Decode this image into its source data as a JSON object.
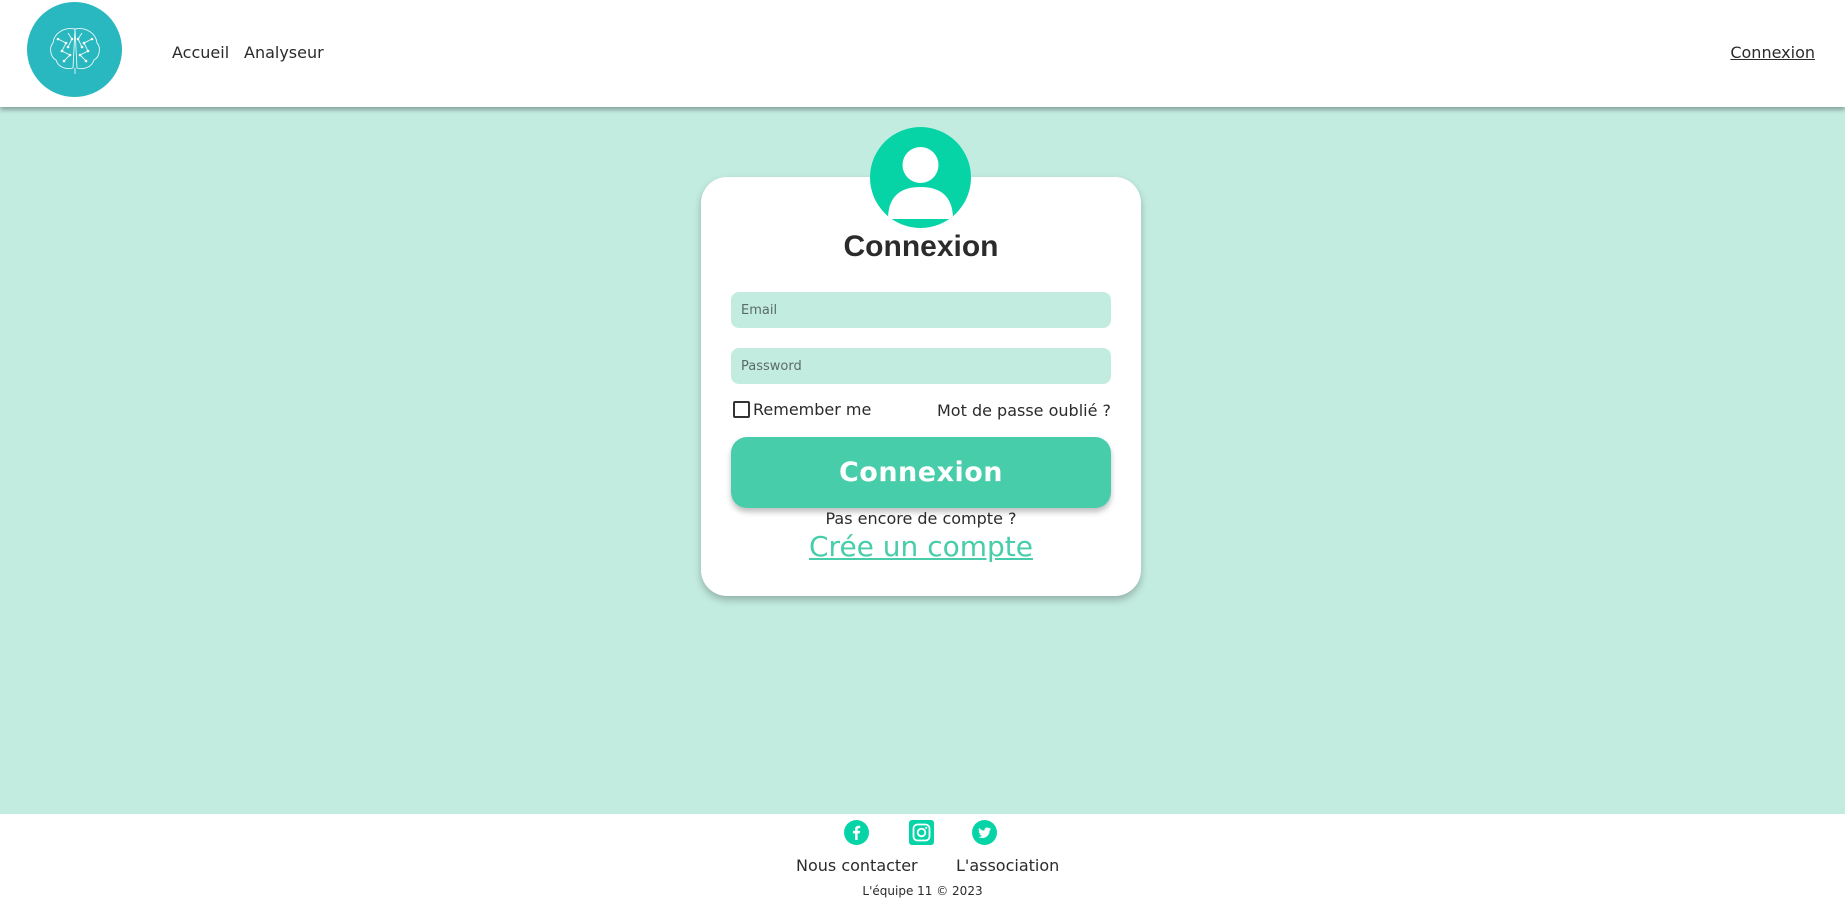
{
  "header": {
    "logo_icon": "brain-icon",
    "nav": [
      {
        "label": "Accueil"
      },
      {
        "label": "Analyseur"
      }
    ],
    "login_link": "Connexion"
  },
  "login": {
    "avatar_icon": "user-icon",
    "title": "Connexion",
    "email_placeholder": "Email",
    "email_value": "",
    "password_placeholder": "Password",
    "password_value": "",
    "remember_label": "Remember me",
    "remember_checked": false,
    "forgot_label": "Mot de passe oublié ?",
    "submit_label": "Connexion",
    "no_account_text": "Pas encore de compte ?",
    "create_account_label": "Crée un compte"
  },
  "footer": {
    "social_icons": [
      "facebook-icon",
      "instagram-icon",
      "twitter-icon"
    ],
    "links": [
      {
        "label": "Nous contacter"
      },
      {
        "label": "L'association"
      }
    ],
    "copyright": "L'équipe 11 © 2023"
  },
  "colors": {
    "page_background": "#c3ece1",
    "accent": "#48cdab",
    "avatar": "#06d4a7",
    "logo": "#29b8bf"
  }
}
